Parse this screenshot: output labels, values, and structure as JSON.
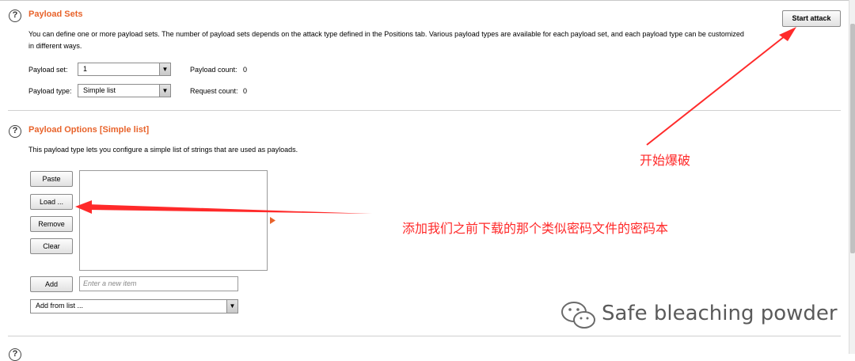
{
  "payload_sets": {
    "title": "Payload Sets",
    "description": "You can define one or more payload sets. The number of payload sets depends on the attack type defined in the Positions tab. Various payload types are available for each payload set, and each payload type can be customized in different ways.",
    "payload_set_label": "Payload set:",
    "payload_set_value": "1",
    "payload_type_label": "Payload type:",
    "payload_type_value": "Simple list",
    "payload_count_label": "Payload count:",
    "payload_count_value": "0",
    "request_count_label": "Request count:",
    "request_count_value": "0",
    "start_attack_label": "Start attack"
  },
  "payload_options": {
    "title": "Payload Options [Simple list]",
    "description": "This payload type lets you configure a simple list of strings that are used as payloads.",
    "buttons": {
      "paste": "Paste",
      "load": "Load ...",
      "remove": "Remove",
      "clear": "Clear",
      "add": "Add"
    },
    "new_item_placeholder": "Enter a new item",
    "add_from_list_label": "Add from list ..."
  },
  "help_icon_glyph": "?",
  "dropdown_arrow_glyph": "▼",
  "annotations": {
    "start_attack_note": "开始爆破",
    "load_note": "添加我们之前下载的那个类似密码文件的密码本",
    "color": "#ff2a2a"
  },
  "watermark": {
    "text": "Safe bleaching powder",
    "icon": "wechat-icon"
  },
  "colors": {
    "section_title": "#e8632b"
  }
}
